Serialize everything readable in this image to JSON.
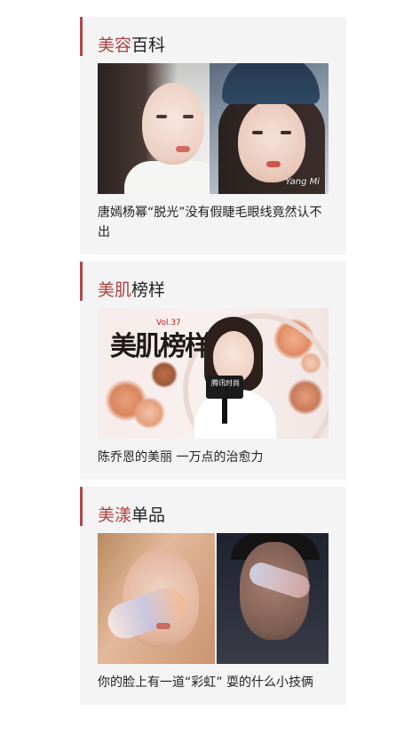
{
  "sections": [
    {
      "title_accent": "美容",
      "title_rest": "百科",
      "caption": "唐嫣杨幂“脱光”没有假睫毛眼线竟然认不出",
      "image_signature": "Yang Mi"
    },
    {
      "title_accent": "美肌",
      "title_rest": "榜样",
      "caption": "陈乔恩的美丽 一万点的治愈力",
      "logo_text": "美肌榜样",
      "logo_small": "Vol.37",
      "mic_text": "腾讯时尚"
    },
    {
      "title_accent": "美漾",
      "title_rest": "单品",
      "caption": "你的脸上有一道“彩虹” 耍的什么小技俩"
    }
  ],
  "colors": {
    "accent": "#a94442",
    "bar": "#b0474c",
    "card_bg": "#f5f4f4",
    "text": "#222222"
  }
}
